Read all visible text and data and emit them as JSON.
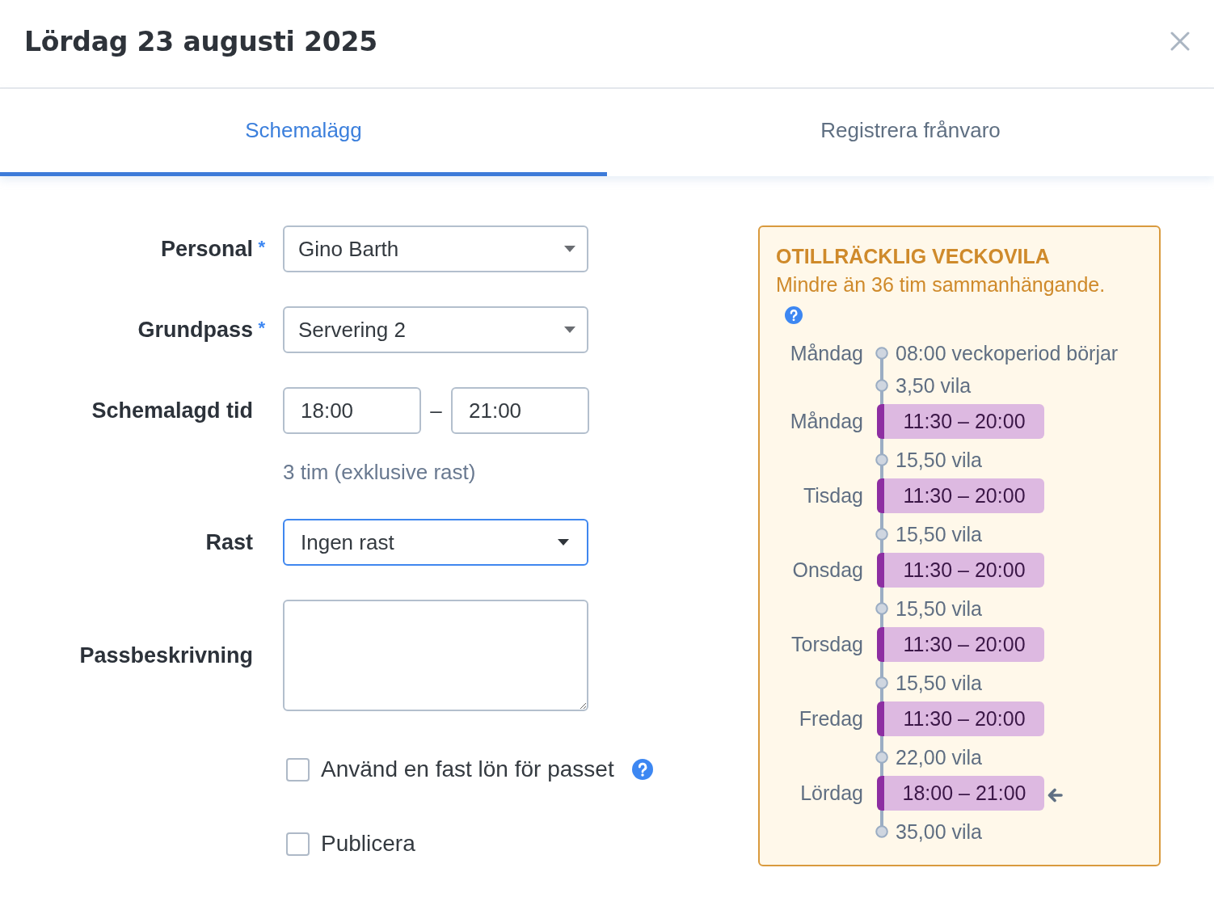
{
  "dialog": {
    "title": "Lördag 23 augusti 2025"
  },
  "tabs": [
    {
      "label": "Schemalägg",
      "selected": true
    },
    {
      "label": "Registrera frånvaro",
      "selected": false
    }
  ],
  "form": {
    "fields": [
      {
        "kind": "select",
        "label": "Personal",
        "required_mark": "*",
        "value": "Gino Barth",
        "focused": false
      },
      {
        "kind": "select",
        "label": "Grundpass",
        "required_mark": "*",
        "value": "Servering 2",
        "focused": false
      },
      {
        "kind": "time_range",
        "label": "Schemalagd tid",
        "start": "18:00",
        "separator": "–",
        "end": "21:00",
        "hint": "3 tim (exklusive rast)"
      },
      {
        "kind": "select",
        "label": "Rast",
        "value": "Ingen rast",
        "focused": true
      },
      {
        "kind": "textarea",
        "label": "Passbeskrivning"
      }
    ],
    "checkboxes": [
      {
        "label": "Använd en fast lön för passet",
        "checked": false,
        "has_help": true
      },
      {
        "label": "Publicera",
        "checked": false,
        "has_help": false
      }
    ]
  },
  "warning": {
    "title": "OTILLRÄCKLIG VECKOVILA",
    "message": "Mindre än 36 tim sammanhängande.",
    "timeline": [
      {
        "kind": "point",
        "day": "Måndag",
        "text": "08:00 veckoperiod börjar"
      },
      {
        "kind": "point",
        "text": "3,50 vila"
      },
      {
        "kind": "shift",
        "day": "Måndag",
        "time": "11:30 – 20:00",
        "current": false
      },
      {
        "kind": "point",
        "text": "15,50 vila"
      },
      {
        "kind": "shift",
        "day": "Tisdag",
        "time": "11:30 – 20:00",
        "current": false
      },
      {
        "kind": "point",
        "text": "15,50 vila"
      },
      {
        "kind": "shift",
        "day": "Onsdag",
        "time": "11:30 – 20:00",
        "current": false
      },
      {
        "kind": "point",
        "text": "15,50 vila"
      },
      {
        "kind": "shift",
        "day": "Torsdag",
        "time": "11:30 – 20:00",
        "current": false
      },
      {
        "kind": "point",
        "text": "15,50 vila"
      },
      {
        "kind": "shift",
        "day": "Fredag",
        "time": "11:30 – 20:00",
        "current": false
      },
      {
        "kind": "point",
        "text": "22,00 vila"
      },
      {
        "kind": "shift",
        "day": "Lördag",
        "time": "18:00 – 21:00",
        "current": true
      },
      {
        "kind": "point",
        "text": "35,00 vila"
      }
    ]
  }
}
